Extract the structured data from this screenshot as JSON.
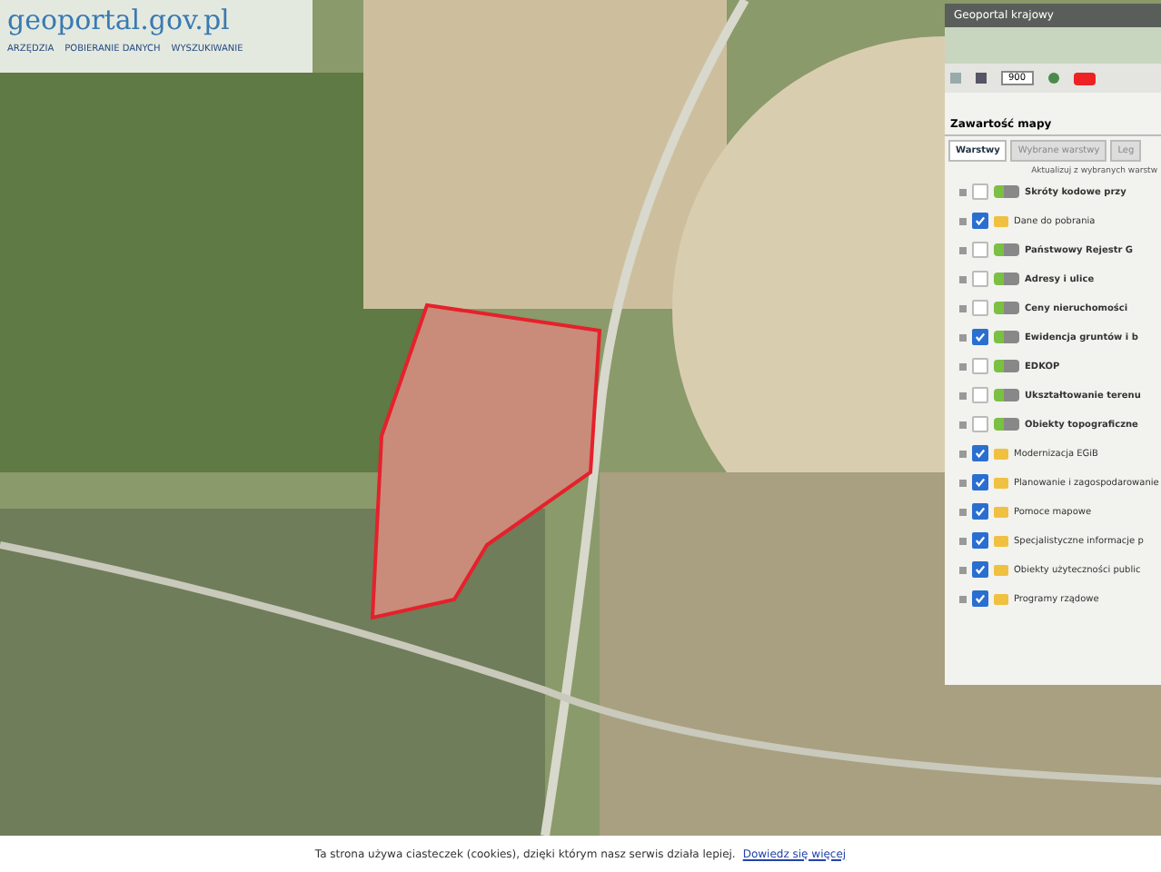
{
  "header": {
    "logo": "geoportal.gov.pl",
    "menu": [
      {
        "label": "ARZĘDZIA"
      },
      {
        "label": "POBIERANIE DANYCH"
      },
      {
        "label": "WYSZUKIWANIE"
      }
    ]
  },
  "panel": {
    "title": "Geoportal krajowy",
    "scale": "900",
    "section_title": "Zawartość mapy",
    "tabs": [
      {
        "label": "Warstwy",
        "selected": true
      },
      {
        "label": "Wybrane warstwy",
        "selected": false
      },
      {
        "label": "Leg",
        "selected": false
      }
    ],
    "note": "Aktualizuj z wybranych warstw",
    "layers": [
      {
        "kind": "service",
        "label": "Skróty kodowe przy",
        "checked": false
      },
      {
        "kind": "folder",
        "label": "Dane do pobrania",
        "checked": true
      },
      {
        "kind": "service",
        "label": "Państwowy Rejestr G",
        "checked": false
      },
      {
        "kind": "service",
        "label": "Adresy i ulice",
        "checked": false
      },
      {
        "kind": "service",
        "label": "Ceny nieruchomości",
        "checked": false
      },
      {
        "kind": "service",
        "label": "Ewidencja gruntów i b",
        "checked": true
      },
      {
        "kind": "service",
        "label": "EDKOP",
        "checked": false
      },
      {
        "kind": "service",
        "label": "Ukształtowanie terenu",
        "checked": false
      },
      {
        "kind": "service",
        "label": "Obiekty topograficzne",
        "checked": false
      },
      {
        "kind": "folder",
        "label": "Modernizacja EGiB",
        "checked": true
      },
      {
        "kind": "folder",
        "label": "Planowanie i zagospodarowanie",
        "checked": true
      },
      {
        "kind": "folder",
        "label": "Pomoce mapowe",
        "checked": true
      },
      {
        "kind": "folder",
        "label": "Specjalistyczne informacje p",
        "checked": true
      },
      {
        "kind": "folder",
        "label": "Obiekty użyteczności public",
        "checked": true
      },
      {
        "kind": "folder",
        "label": "Programy rządowe",
        "checked": true
      }
    ]
  },
  "cookie_bar": {
    "text": "Ta strona używa ciasteczek (cookies), dzięki którym nasz serwis działa lepiej.",
    "link": "Dowiedz się więcej"
  }
}
